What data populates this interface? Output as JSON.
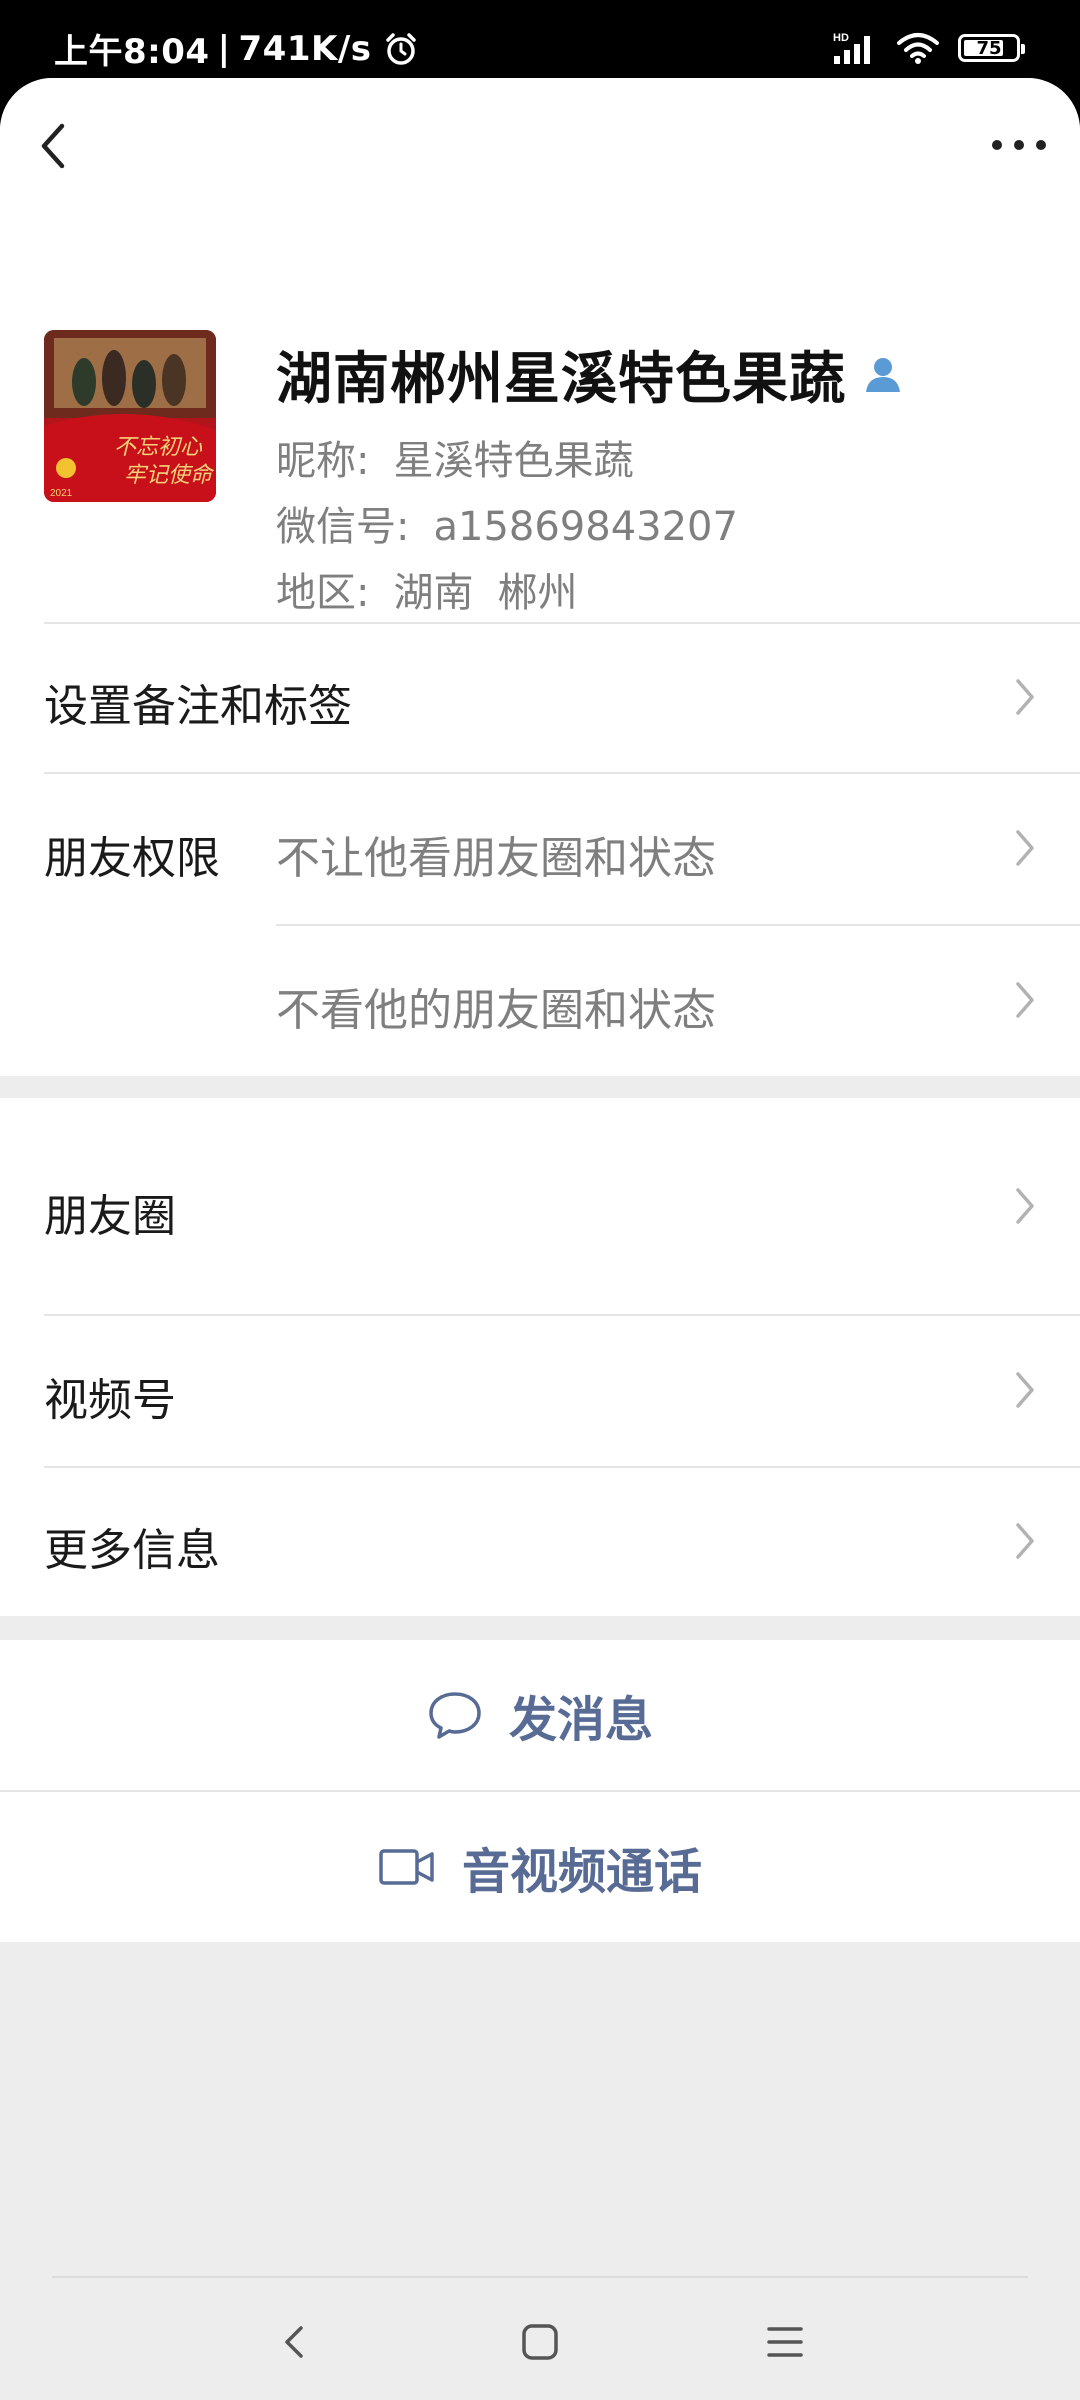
{
  "status_bar": {
    "time": "上午8:04",
    "separator": "|",
    "net_speed": "741K/s",
    "hd_label": "HD",
    "battery_level": "75",
    "icons": [
      "alarm-icon",
      "signal-icon",
      "wifi-icon",
      "battery-icon"
    ]
  },
  "nav": {
    "back_icon": "back-chevron-icon",
    "more_icon": "more-dots-icon"
  },
  "profile": {
    "name": "湖南郴州星溪特色果蔬",
    "nickname_label": "昵称:",
    "nickname": "星溪特色果蔬",
    "wechat_id_label": "微信号:",
    "wechat_id": "a15869843207",
    "region_label": "地区:",
    "region_province": "湖南",
    "region_city": "郴州",
    "avatar_text_line1": "不忘初心",
    "avatar_text_line2": "牢记使命",
    "avatar_year": "2021"
  },
  "rows": {
    "remarks": "设置备注和标签",
    "permissions_label": "朋友权限",
    "perm_hide_mine": "不让他看朋友圈和状态",
    "perm_hide_his": "不看他的朋友圈和状态",
    "moments": "朋友圈",
    "channels": "视频号",
    "more_info": "更多信息"
  },
  "actions": {
    "send_message": "发消息",
    "call": "音视频通话"
  },
  "colors": {
    "link_blue": "#576b95",
    "secondary_text": "#7f7f7f",
    "verified_blue": "#5b9bd5",
    "page_bg": "#ededed"
  }
}
